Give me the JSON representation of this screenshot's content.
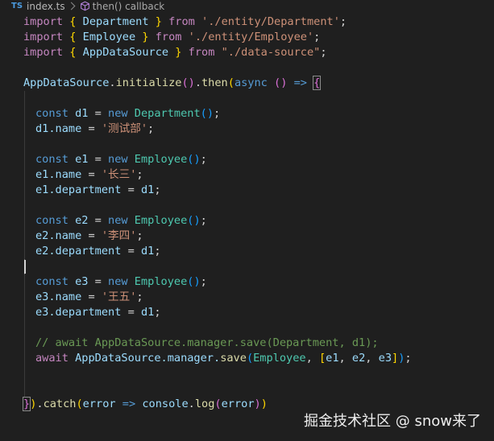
{
  "breadcrumb": {
    "language_badge": "TS",
    "file": "index.ts",
    "symbol": "then() callback",
    "symbol_icon": "cube-icon"
  },
  "code": {
    "line1": {
      "k": "import",
      "b1": "{",
      "name": "Department",
      "b2": "}",
      "from": "from",
      "path": "'./entity/Department'",
      "semi": ";"
    },
    "line2": {
      "k": "import",
      "b1": "{",
      "name": "Employee",
      "b2": "}",
      "from": "from",
      "path": "'./entity/Employee'",
      "semi": ";"
    },
    "line3": {
      "k": "import",
      "b1": "{",
      "name": "AppDataSource",
      "b2": "}",
      "from": "from",
      "path": "\"./data-source\"",
      "semi": ";"
    },
    "line5": {
      "obj": "AppDataSource",
      "dot": ".",
      "fn": "initialize",
      "call": "()",
      "dot2": ".",
      "then": "then",
      "po": "(",
      "async": "async",
      "params": "()",
      "arrow": "=>",
      "brace": "{"
    },
    "line7": {
      "k": "const",
      "v": "d1",
      "eq": "=",
      "nw": "new",
      "ty": "Department",
      "call": "()",
      "semi": ";"
    },
    "line8": {
      "obj": "d1",
      "prop": ".name",
      "eq": "=",
      "val": "'测试部'",
      "semi": ";"
    },
    "line10": {
      "k": "const",
      "v": "e1",
      "eq": "=",
      "nw": "new",
      "ty": "Employee",
      "call": "()",
      "semi": ";"
    },
    "line11": {
      "obj": "e1",
      "prop": ".name",
      "eq": "=",
      "val": "'长三'",
      "semi": ";"
    },
    "line12": {
      "obj": "e1",
      "prop": ".department",
      "eq": "=",
      "val": "d1",
      "semi": ";"
    },
    "line14": {
      "k": "const",
      "v": "e2",
      "eq": "=",
      "nw": "new",
      "ty": "Employee",
      "call": "()",
      "semi": ";"
    },
    "line15": {
      "obj": "e2",
      "prop": ".name",
      "eq": "=",
      "val": "'李四'",
      "semi": ";"
    },
    "line16": {
      "obj": "e2",
      "prop": ".department",
      "eq": "=",
      "val": "d1",
      "semi": ";"
    },
    "line18": {
      "k": "const",
      "v": "e3",
      "eq": "=",
      "nw": "new",
      "ty": "Employee",
      "call": "()",
      "semi": ";"
    },
    "line19": {
      "obj": "e3",
      "prop": ".name",
      "eq": "=",
      "val": "'王五'",
      "semi": ";"
    },
    "line20": {
      "obj": "e3",
      "prop": ".department",
      "eq": "=",
      "val": "d1",
      "semi": ";"
    },
    "line22": {
      "comment": "// await AppDataSource.manager.save(Department, d1);"
    },
    "line23": {
      "aw": "await",
      "obj": "AppDataSource",
      "prop": ".manager.",
      "fn": "save",
      "po": "(",
      "ty": "Employee",
      "comma": ",",
      "bo": "[",
      "a": "e1",
      "c1": ",",
      "b": "e2",
      "c2": ",",
      "c": "e3",
      "bc": "]",
      "pc": ")",
      "semi": ";"
    },
    "line26": {
      "brace": "}",
      "pc": ")",
      "dot": ".",
      "fn": "catch",
      "po": "(",
      "p": "error",
      "arrow": "=>",
      "obj": "console",
      "dot2": ".",
      "log": "log",
      "po2": "(",
      "arg": "error",
      "pc2": ")",
      "pc3": ")"
    }
  },
  "watermark": "掘金技术社区 @ snow来了",
  "colors": {
    "background": "#1f1f1f",
    "keyword": "#c586c0",
    "storage": "#569cd6",
    "type": "#4ec9b0",
    "function": "#dcdcaa",
    "variable": "#9cdcfe",
    "string": "#ce9178",
    "comment": "#6a9955"
  }
}
